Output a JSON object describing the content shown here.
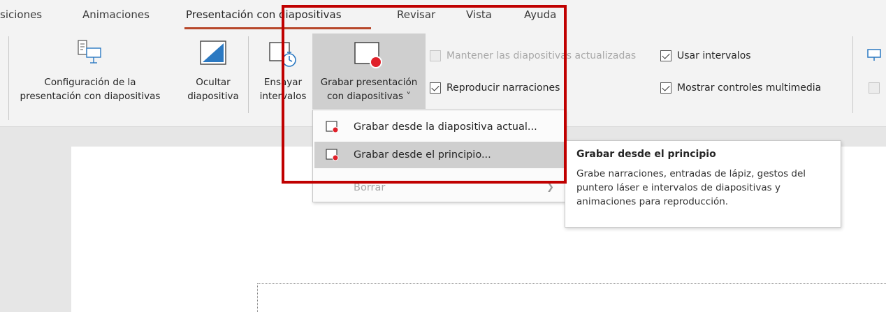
{
  "tabs": {
    "transiciones": "siciones",
    "animaciones": "Animaciones",
    "presentacion": "Presentación con diapositivas",
    "revisar": "Revisar",
    "vista": "Vista",
    "ayuda": "Ayuda"
  },
  "ribbon": {
    "configuracion": [
      "Configuración de la",
      "presentación con diapositivas"
    ],
    "ocultar": [
      "Ocultar",
      "diapositiva"
    ],
    "ensayar": [
      "Ensayar",
      "intervalos"
    ],
    "grabar": [
      "Grabar presentación",
      "con diapositivas ˅"
    ],
    "mantener": "Mantener las diapositivas actualizadas",
    "usar_intervalos": "Usar intervalos",
    "reproducir": "Reproducir narraciones",
    "mostrar_controles": "Mostrar controles multimedia"
  },
  "checkboxes": {
    "mantener_checked": false,
    "usar_intervalos_checked": true,
    "reproducir_checked": true,
    "mostrar_controles_checked": true
  },
  "menu": {
    "item1": "Grabar desde la diapositiva actual...",
    "item2": "Grabar desde el principio...",
    "item3": "Borrar"
  },
  "tooltip": {
    "title": "Grabar desde el principio",
    "body": "Grabe narraciones, entradas de lápiz, gestos del puntero láser e intervalos de diapositivas y animaciones para reproducción."
  },
  "colors": {
    "accent": "#b7472a",
    "highlight": "#c00000",
    "record_dot": "#e0202a"
  },
  "icons": {
    "setup": "slideshow-setup-icon",
    "hide": "hide-slide-icon",
    "rehearse": "rehearse-timings-icon",
    "record": "record-slideshow-icon",
    "monitor": "monitor-icon"
  }
}
